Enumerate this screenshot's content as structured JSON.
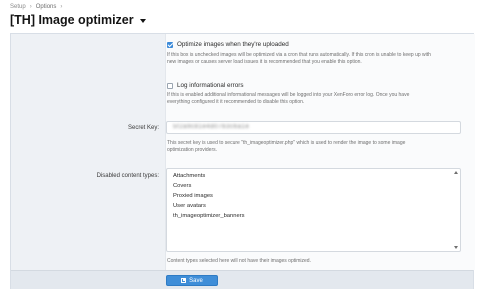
{
  "breadcrumb": {
    "items": [
      "Setup",
      "Options"
    ],
    "separator": "›"
  },
  "page": {
    "title": "[TH] Image optimizer"
  },
  "options": {
    "optimize": {
      "label": "Optimize images when they're uploaded",
      "checked": true,
      "hint_line1": "If this box is unchecked images will be optimized via a cron that runs automatically. If this cron is unable to keep up with",
      "hint_line2": "new images or causes server load issues it is recommended that you enable this option."
    },
    "log": {
      "label": "Log informational errors",
      "checked": false,
      "hint_line1": "If this is enabled additional informational messages will be logged into your XenForo error log. Once you have",
      "hint_line2": "everything configured it it recommended to disable this option."
    },
    "secret_key": {
      "label": "Secret Key:",
      "value": "5f2a9c81e4d07b3c6a1e",
      "hint_line1": "This secret key is used to secure \"th_imageoptimizer.php\" which is used to render the image to some image",
      "hint_line2": "optimization providers."
    },
    "content_types": {
      "label": "Disabled content types:",
      "options": [
        "Attachments",
        "Covers",
        "Proxied images",
        "User avatars",
        "th_imageoptimizer_banners"
      ],
      "hint": "Content types selected here will not have their images optimized."
    }
  },
  "footer": {
    "save_label": "Save"
  },
  "colors": {
    "accent": "#3f8ed8",
    "panel_bg": "#eef1f5",
    "footer_bg": "#e3e8ee"
  }
}
